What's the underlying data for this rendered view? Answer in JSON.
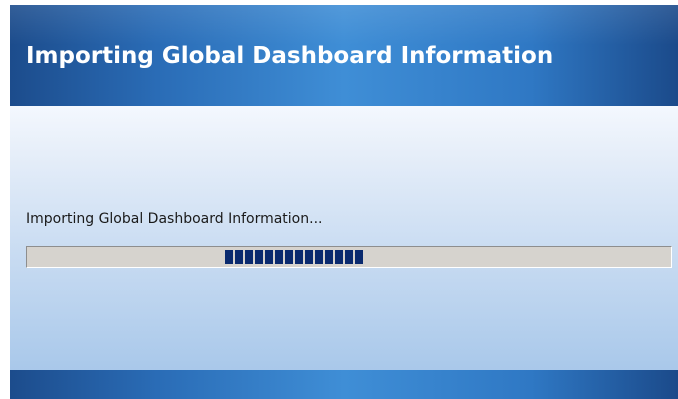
{
  "window": {
    "title": "Importing Global Dashboard Information"
  },
  "main": {
    "status_text": "Importing Global Dashboard Information...",
    "progress": {
      "mode": "marquee",
      "block_count": 14,
      "block_color": "#0a2a6e"
    }
  },
  "colors": {
    "header_blue": "#2a6cb6",
    "progress_track": "#d6d3ce"
  }
}
